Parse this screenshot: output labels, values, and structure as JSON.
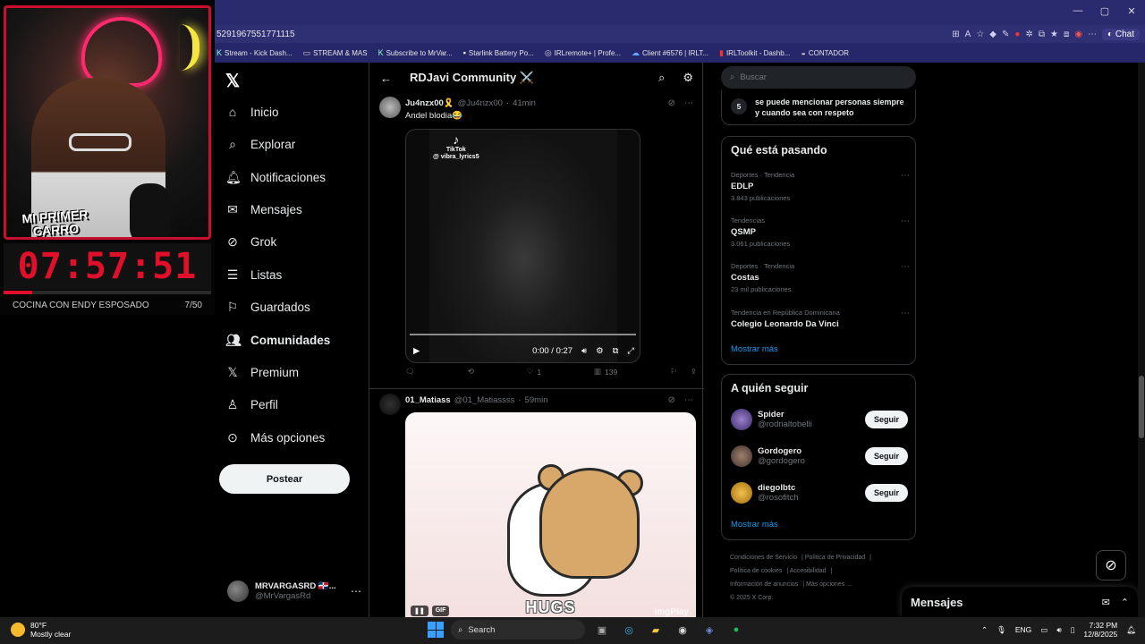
{
  "overlay": {
    "cam_label_1": "MI PRIMER",
    "cam_label_2": "CARRO",
    "timer": "07:57:51",
    "goal_text": "COCINA CON ENDY ESPOSADO",
    "goal_count": "7/50",
    "goal_progress": 0.14,
    "accent": "#e0102a"
  },
  "browser": {
    "url": "5291967551771115",
    "chat_label": "Chat",
    "bookmarks": [
      {
        "label": "Stream - Kick Dash...",
        "icon": "kick-icon"
      },
      {
        "label": "STREAM & MAS",
        "icon": "folder-icon"
      },
      {
        "label": "Subscribe to MrVar...",
        "icon": "kick-icon"
      },
      {
        "label": "Starlink Battery Po...",
        "icon": "starlink-icon"
      },
      {
        "label": "IRLremote+ | Profe...",
        "icon": "globe-icon"
      },
      {
        "label": "Client #6576 | IRLT...",
        "icon": "cloud-icon"
      },
      {
        "label": "IRLToolkit - Dashb...",
        "icon": "irltoolkit-icon"
      },
      {
        "label": "CONTADOR",
        "icon": "contador-icon"
      }
    ]
  },
  "nav": {
    "items": [
      {
        "label": "Inicio",
        "icon": "home-icon"
      },
      {
        "label": "Explorar",
        "icon": "search-icon"
      },
      {
        "label": "Notificaciones",
        "icon": "bell-icon"
      },
      {
        "label": "Mensajes",
        "icon": "mail-icon"
      },
      {
        "label": "Grok",
        "icon": "grok-icon"
      },
      {
        "label": "Listas",
        "icon": "list-icon"
      },
      {
        "label": "Guardados",
        "icon": "bookmark-icon"
      },
      {
        "label": "Comunidades",
        "icon": "communities-icon"
      },
      {
        "label": "Premium",
        "icon": "x-icon"
      },
      {
        "label": "Perfil",
        "icon": "person-icon"
      },
      {
        "label": "Más opciones",
        "icon": "more-icon"
      }
    ],
    "post_label": "Postear",
    "profile_name": "MRVARGASRD 🇩🇴...",
    "profile_handle": "@MrVargasRd"
  },
  "feed": {
    "title": "RDJavi Community ⚔️",
    "tweet1": {
      "name": "Ju4nzx00🎗️",
      "handle": "@Ju4nzx00",
      "time": "41min",
      "text": "Andel blodia😂",
      "tiktok_handle": "@ vibra_lyrics5",
      "video_time": "0:00 / 0:27",
      "likes": "1",
      "views": "139"
    },
    "tweet2": {
      "name": "01_Matiass",
      "handle": "@01_Matiassss",
      "time": "59min",
      "gif_caption": "HUGS",
      "gif_badge": "GIF",
      "watermark": "imgPlay"
    }
  },
  "right": {
    "search_placeholder": "Buscar",
    "rule_number": "5",
    "rule_text": "se puede mencionar personas siempre y cuando sea con respeto",
    "trending_title": "Qué está pasando",
    "trends": [
      {
        "category": "Deportes · Tendencia",
        "name": "EDLP",
        "count": "3.843 publicaciones"
      },
      {
        "category": "Tendencias",
        "name": "QSMP",
        "count": "3.061 publicaciones"
      },
      {
        "category": "Deportes · Tendencia",
        "name": "Costas",
        "count": "23 mil publicaciones"
      },
      {
        "category": "Tendencia en República Dominicana",
        "name": "Colegio Leonardo Da Vinci",
        "count": ""
      }
    ],
    "show_more": "Mostrar más",
    "follow_title": "A quién seguir",
    "follow": [
      {
        "name": "Spider",
        "handle": "@rodrialtobelli",
        "button": "Seguir"
      },
      {
        "name": "Gordogero",
        "handle": "@gordogero",
        "button": "Seguir"
      },
      {
        "name": "diegolbtc",
        "handle": "@rosofitch",
        "button": "Seguir"
      }
    ],
    "footer": [
      "Condiciones de Servicio",
      "Política de Privacidad",
      "Política de cookies",
      "Accesibilidad",
      "Información de anuncios",
      "Más opciones ...",
      "© 2025 X Corp."
    ],
    "messages_title": "Mensajes"
  },
  "taskbar": {
    "temp": "80°F",
    "weather": "Mostly clear",
    "search": "Search",
    "lang": "ENG",
    "time": "7:32 PM",
    "date": "12/8/2025"
  }
}
